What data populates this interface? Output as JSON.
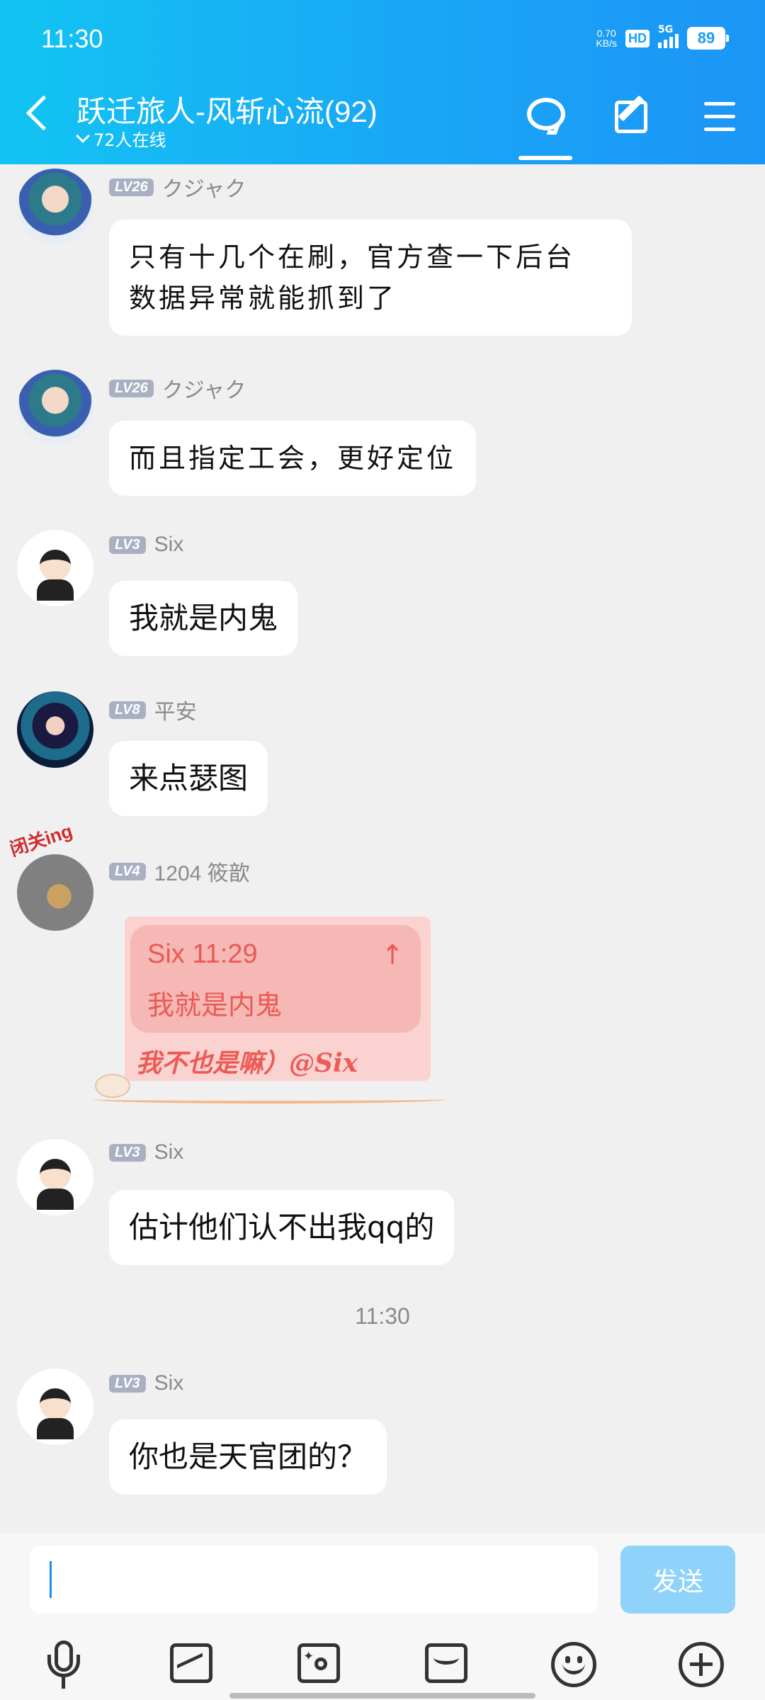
{
  "status_bar": {
    "time": "11:30",
    "net_speed_value": "0.70",
    "net_speed_unit": "KB/s",
    "hd": "HD",
    "network": "5G",
    "battery": "89"
  },
  "header": {
    "title": "跃迁旅人-风斩心流(92)",
    "online": "72人在线"
  },
  "messages": [
    {
      "level": "LV26",
      "sender": "クジャク",
      "text_line1": "只有十几个在刷，官方查一下后台",
      "text_line2": "数据异常就能抓到了"
    },
    {
      "level": "LV26",
      "sender": "クジャク",
      "text": "而且指定工会，更好定位"
    },
    {
      "level": "LV3",
      "sender": "Six",
      "text": "我就是内鬼"
    },
    {
      "level": "LV8",
      "sender": "平安",
      "text": "来点瑟图"
    },
    {
      "level": "LV4",
      "sender": "1204 筱歆",
      "avatar_tag": "闭关ing",
      "quote_sender": "Six 11:29",
      "quote_arrow": "↑",
      "quote_text": "我就是内鬼",
      "text": "我不也是嘛）@Six"
    },
    {
      "level": "LV3",
      "sender": "Six",
      "text": "估计他们认不出我qq的"
    },
    {
      "level": "LV3",
      "sender": "Six",
      "text": "你也是天官团的？"
    }
  ],
  "time_separator": "11:30",
  "input_bar": {
    "placeholder": "",
    "send_label": "发送"
  },
  "toolbar_icons": [
    "microphone-icon",
    "picture-icon",
    "camera-icon",
    "red-packet-icon",
    "emoji-icon",
    "plus-icon"
  ],
  "colors": {
    "header_start": "#12c4f3",
    "header_end": "#1b95f5",
    "send_button": "#8fd2fa",
    "quote_text": "#ea5a55"
  }
}
